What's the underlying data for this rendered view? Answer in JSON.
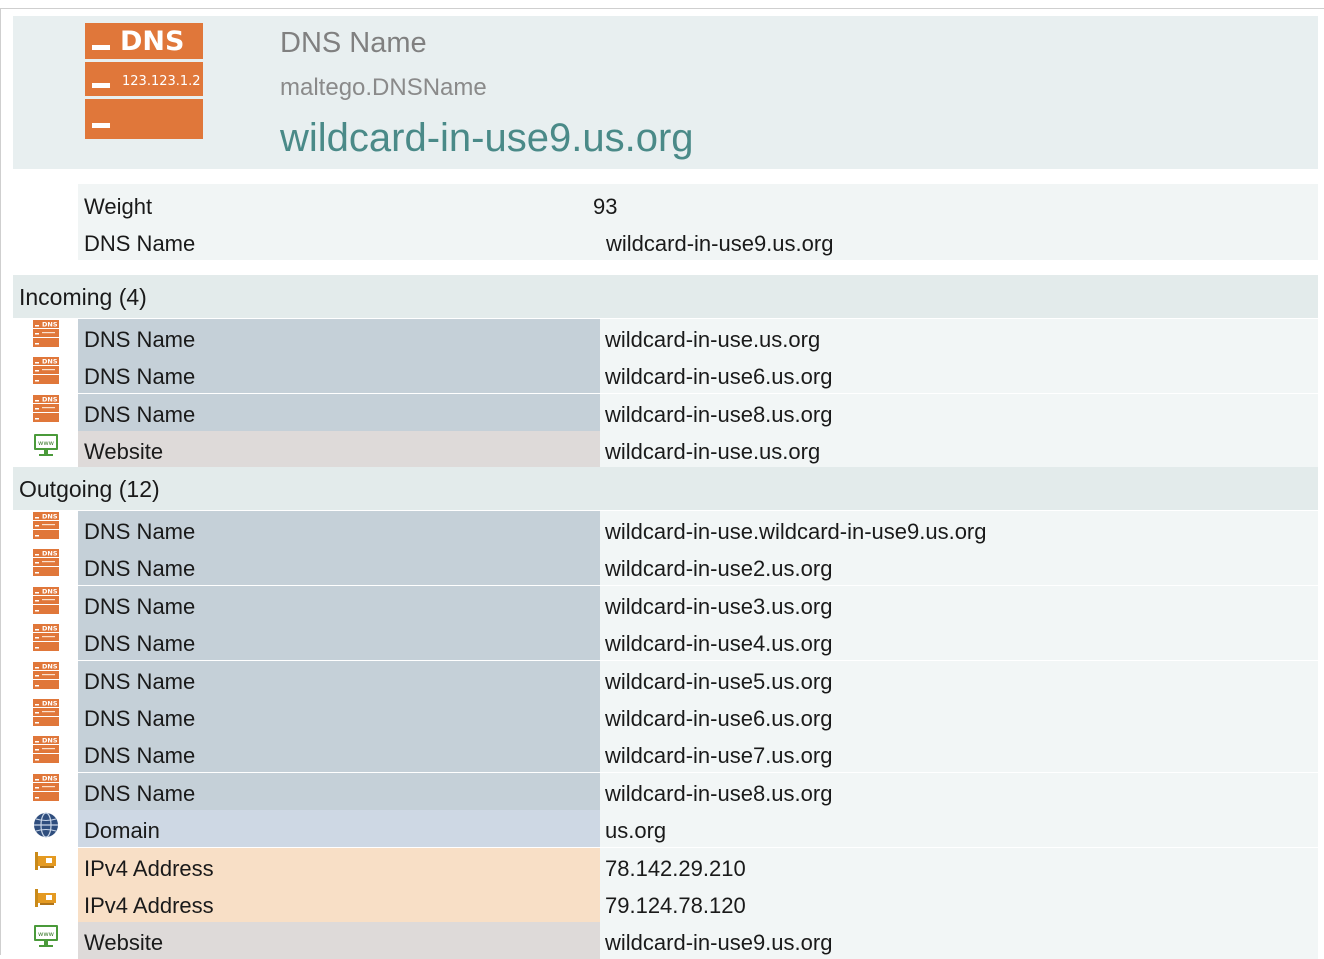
{
  "entity": {
    "type_name": "DNS Name",
    "type_id": "maltego.DNSName",
    "value": "wildcard-in-use9.us.org",
    "icon": "dns-server-icon",
    "icon_title": "DNS",
    "icon_ip": "123.123.1.2"
  },
  "properties": [
    {
      "key": "Weight",
      "value": "93"
    },
    {
      "key": "DNS Name",
      "value": "wildcard-in-use9.us.org"
    }
  ],
  "incoming": {
    "label": "Incoming (4)",
    "items": [
      {
        "type": "DNS Name",
        "value": "wildcard-in-use.us.org",
        "icon": "dns-server-icon"
      },
      {
        "type": "DNS Name",
        "value": "wildcard-in-use6.us.org",
        "icon": "dns-server-icon"
      },
      {
        "type": "DNS Name",
        "value": "wildcard-in-use8.us.org",
        "icon": "dns-server-icon"
      },
      {
        "type": "Website",
        "value": "wildcard-in-use.us.org",
        "icon": "website-monitor-icon"
      }
    ]
  },
  "outgoing": {
    "label": "Outgoing (12)",
    "items": [
      {
        "type": "DNS Name",
        "value": "wildcard-in-use.wildcard-in-use9.us.org",
        "icon": "dns-server-icon"
      },
      {
        "type": "DNS Name",
        "value": "wildcard-in-use2.us.org",
        "icon": "dns-server-icon"
      },
      {
        "type": "DNS Name",
        "value": "wildcard-in-use3.us.org",
        "icon": "dns-server-icon"
      },
      {
        "type": "DNS Name",
        "value": "wildcard-in-use4.us.org",
        "icon": "dns-server-icon"
      },
      {
        "type": "DNS Name",
        "value": "wildcard-in-use5.us.org",
        "icon": "dns-server-icon"
      },
      {
        "type": "DNS Name",
        "value": "wildcard-in-use6.us.org",
        "icon": "dns-server-icon"
      },
      {
        "type": "DNS Name",
        "value": "wildcard-in-use7.us.org",
        "icon": "dns-server-icon"
      },
      {
        "type": "DNS Name",
        "value": "wildcard-in-use8.us.org",
        "icon": "dns-server-icon"
      },
      {
        "type": "Domain",
        "value": "us.org",
        "icon": "globe-icon"
      },
      {
        "type": "IPv4 Address",
        "value": "78.142.29.210",
        "icon": "network-card-icon"
      },
      {
        "type": "IPv4 Address",
        "value": "79.124.78.120",
        "icon": "network-card-icon"
      },
      {
        "type": "Website",
        "value": "wildcard-in-use9.us.org",
        "icon": "website-monitor-icon"
      }
    ]
  },
  "colors": {
    "header_bg": "#e8eff0",
    "entity_value": "#4a8a88",
    "dns_row": "#c5d0d8",
    "website_row": "#dedad9",
    "domain_row": "#ced8e4",
    "ip_row": "#f8dfc6",
    "dns_icon": "#e0773a",
    "website_icon": "#4a9a3a",
    "globe_icon": "#2f4e7e",
    "ip_icon": "#d9901f"
  }
}
